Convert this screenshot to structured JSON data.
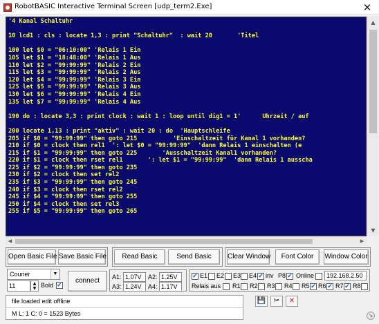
{
  "window": {
    "title": "RobotBASIC Interactive Terminal Screen  [udp_term2.Exe]",
    "close": "✕"
  },
  "terminal": {
    "bg_color": "#0a0a6e",
    "text_color": "#ffff33",
    "lines": [
      "'4 Kanal Schaltuhr",
      "",
      "10 lcd1 : cls : locate 1,3 : print \"Schaltuhr\"  : wait 20       'Titel",
      "",
      "100 let $0 = \"06:10:00\" 'Relais 1 Ein",
      "105 let $1 = \"18:48:00\" 'Relais 1 Aus",
      "110 let $2 = \"99:99:99\" 'Relais 2 Ein",
      "115 let $3 = \"99:99:99\" 'Relais 2 Aus",
      "120 let $4 = \"99:99:99\" 'Relais 3 Ein",
      "125 let $5 = \"99:99:99\" 'Relais 3 Aus",
      "130 let $6 = \"99:99:99\" 'Relais 4 Ein",
      "135 let $7 = \"99:99:99\" 'Relais 4 Aus",
      "",
      "190 do : locate 3,3 : print clock : wait 1 : loop until dig1 = 1'      Uhrzeit / auf",
      "",
      "200 locate 1,13 : print \"aktiv\" : wait 20 : do  'Hauptschleife",
      "205 if $0 = \"99:99:99\" then goto 215          'Einschaltzeit für Kanal 1 vorhanden?",
      "210 if $0 = clock then rel1  ': let $0 = \"99:99:99\"  'dann Relais 1 einschalten (e",
      "215 if $1 = \"99:99:99\" then goto 225       'Ausschaltzeit Kanal1 vorhanden?",
      "220 if $1 = clock then rset rel1       ': let $1 = \"99:99:99\"  'dann Relais 1 ausscha",
      "225 if $2 = \"99:99:99\" then goto 235",
      "230 if $2 = clock then set rel2",
      "235 if $3 = \"99:99:99\" then goto 245",
      "240 if $3 = clock then rset rel2",
      "245 if $4 = \"99:99:99\" then goto 255",
      "250 if $4 = clock then set rel3",
      "255 if $5 = \"99:99:99\" then goto 265"
    ]
  },
  "buttons": {
    "open_basic_file": "Open Basic File",
    "save_basic_file": "Save Basic File",
    "read_basic": "Read Basic",
    "send_basic": "Send Basic",
    "clear_window": "Clear Window",
    "font_color": "Font Color",
    "window_color": "Window Color",
    "connect": "connect"
  },
  "font": {
    "name": "Courier",
    "size": "11",
    "bold_label": "Bold",
    "bold_checked": true
  },
  "analog": [
    {
      "label": "A1:",
      "value": "1.07V"
    },
    {
      "label": "A2:",
      "value": "1.25V"
    },
    {
      "label": "A3:",
      "value": "1.24V"
    },
    {
      "label": "A4:",
      "value": "1.17V"
    }
  ],
  "row1_checks": [
    {
      "label": "E1",
      "checked": true
    },
    {
      "label": "E2",
      "checked": false
    },
    {
      "label": "E3",
      "checked": false
    },
    {
      "label": "E4",
      "checked": false
    },
    {
      "label": "inv",
      "checked": true
    },
    {
      "label": "P8",
      "checked": true
    },
    {
      "label": "Online",
      "checked": false
    }
  ],
  "ip_address": "192.168.2.50",
  "relais_label": "Relais aus",
  "relais_checked": false,
  "row2_checks": [
    {
      "label": "R1",
      "checked": false
    },
    {
      "label": "R2",
      "checked": false
    },
    {
      "label": "R3",
      "checked": false
    },
    {
      "label": "R4",
      "checked": false
    },
    {
      "label": "R5",
      "checked": true
    },
    {
      "label": "R6",
      "checked": true
    },
    {
      "label": "R7",
      "checked": true
    },
    {
      "label": "R8",
      "checked": false
    }
  ],
  "status": {
    "line1": "file loaded   edit offline",
    "line2": "M    L: 1    C: 0   =  1523 Bytes"
  },
  "check_mark": "✔",
  "arrows": {
    "up": "▲",
    "down": "▼",
    "left": "◀",
    "right": "▶"
  },
  "icons": {
    "save": "💾",
    "cut": "✂",
    "delete": "✕",
    "resize": "↘"
  }
}
